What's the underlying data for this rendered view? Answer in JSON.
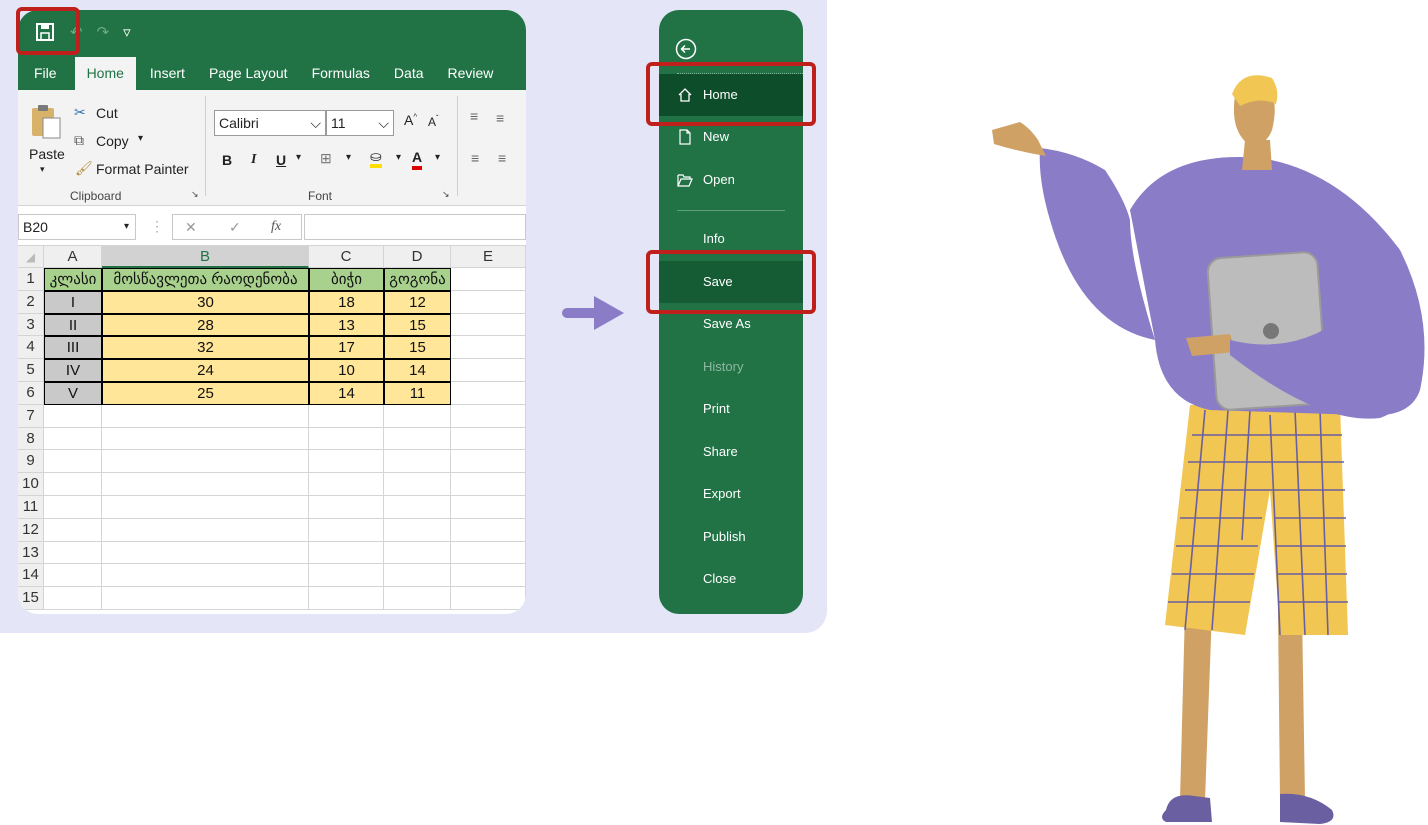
{
  "excel": {
    "qat": {
      "undo": "↶",
      "redo": "↷",
      "more": "▿"
    },
    "tabs": [
      "File",
      "Home",
      "Insert",
      "Page Layout",
      "Formulas",
      "Data",
      "Review"
    ],
    "clipboard": {
      "paste": "Paste",
      "cut": "Cut",
      "copy": "Copy",
      "format_painter": "Format Painter",
      "label": "Clipboard"
    },
    "font": {
      "name": "Calibri",
      "size": "11",
      "bold": "B",
      "italic": "I",
      "underline": "U",
      "label": "Font"
    },
    "formula_bar": {
      "name_box": "B20",
      "fx": "fx",
      "cancel": "✕",
      "enter": "✓"
    },
    "columns": [
      "A",
      "B",
      "C",
      "D",
      "E"
    ],
    "rows": [
      "1",
      "2",
      "3",
      "4",
      "5",
      "6",
      "7",
      "8",
      "9",
      "10",
      "11",
      "12",
      "13",
      "14",
      "15"
    ],
    "table_header": [
      "კლასი",
      "მოსწავლეთა რაოდენობა",
      "ბიჭი",
      "გოგონა"
    ],
    "table_rows": [
      [
        "I",
        "30",
        "18",
        "12"
      ],
      [
        "II",
        "28",
        "13",
        "15"
      ],
      [
        "III",
        "32",
        "17",
        "15"
      ],
      [
        "IV",
        "24",
        "10",
        "14"
      ],
      [
        "V",
        "25",
        "14",
        "11"
      ]
    ]
  },
  "file_menu": {
    "items": [
      {
        "label": "Home",
        "icon": "home-icon"
      },
      {
        "label": "New",
        "icon": "new-doc-icon"
      },
      {
        "label": "Open",
        "icon": "open-folder-icon"
      },
      {
        "label": "Info"
      },
      {
        "label": "Save"
      },
      {
        "label": "Save As"
      },
      {
        "label": "History"
      },
      {
        "label": "Print"
      },
      {
        "label": "Share"
      },
      {
        "label": "Export"
      },
      {
        "label": "Publish"
      },
      {
        "label": "Close"
      }
    ]
  },
  "colors": {
    "excel_green": "#217346",
    "highlight_red": "#c0201b",
    "panel_bg": "#e4e5f6",
    "header_green": "#a9d18e",
    "data_yellow": "#ffe699",
    "class_grey": "#c9c9c9",
    "arrow": "#8b7cc8"
  }
}
